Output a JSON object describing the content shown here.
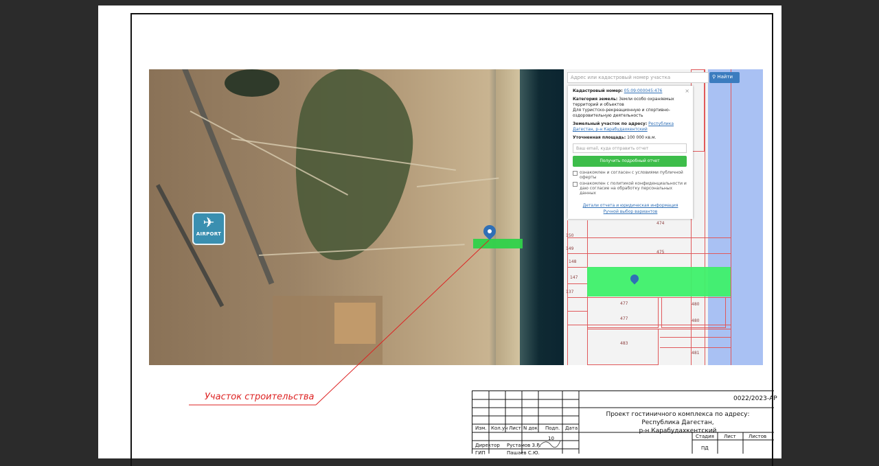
{
  "map_search": {
    "placeholder": "Адрес или кадастровый номер участка",
    "find_label": "Найти",
    "find_icon": "search-icon"
  },
  "popup": {
    "close_symbol": "×",
    "cadastral_label": "Кадастровый номер:",
    "cadastral_value": "05:09:000045:476",
    "category_label": "Категория земель:",
    "category_value": "Земли особо охраняемых территорий и объектов",
    "category_use": "Для туристско-рекреационную и спортивно-оздоровительную деятельность",
    "address_label": "Земельный участок по адресу:",
    "address_value": "Республика Дагестан, р-н Карабудахкентский",
    "area_label": "Уточненная площадь:",
    "area_value": "100 000 кв.м.",
    "email_placeholder": "Ваш email, куда отправить отчет",
    "report_button": "Получить подробный отчет",
    "check1": "ознакомлен и согласен с условиями публичной оферты",
    "check2": "ознакомлен с политикой конфиденциальности и даю согласие на обработку персональных данных",
    "link_details": "Детали отчета и юридическая информация",
    "link_manual": "Ручной выбор вариантов"
  },
  "satellite": {
    "airport_label": "AIRPORT",
    "airport_icon": "airplane-icon"
  },
  "parcel_numbers": [
    "474",
    "475",
    "150",
    "149",
    "148",
    "147",
    "137",
    "477",
    "477",
    "480",
    "480",
    "483",
    "481"
  ],
  "callout_label": "Участок строительства",
  "title_block": {
    "doc_code": "0022/2023-АР",
    "project_line1": "Проект гостиничного комплекса по адресу: Республика Дагестан,",
    "project_line2": "р-н Карабудахкентский",
    "col_headers": [
      "Изм.",
      "Кол.уч",
      "Лист",
      "N док.",
      "Подп.",
      "Дата"
    ],
    "stage_header": "Стадия",
    "sheet_header": "Лист",
    "sheets_header": "Листов",
    "stage_value": "ПД",
    "role1": "Директор",
    "name1": "Рустамов З.Р.",
    "role2": "ГИП",
    "name2": "Пашаев С.Ю.",
    "sign_mark": "10"
  },
  "colors": {
    "callout_red": "#dd2222",
    "parcel_green": "#3ef06a",
    "button_green": "#3dbd4a",
    "button_blue": "#3b7cbf",
    "water_blue": "#a9c1f3"
  }
}
